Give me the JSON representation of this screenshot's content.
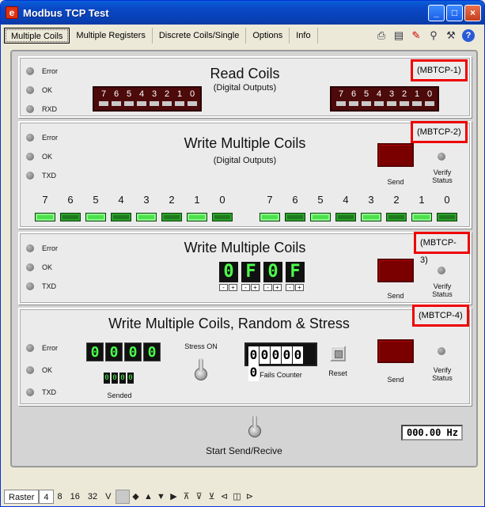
{
  "window": {
    "title": "Modbus TCP Test",
    "minimize": "_",
    "maximize": "□",
    "close": "×"
  },
  "menu": {
    "tabs": [
      "Multiple Coils",
      "Multiple Registers",
      "Discrete Coils/Single",
      "Options",
      "Info"
    ]
  },
  "tools": [
    "printer-icon",
    "clipboard-icon",
    "pen-icon",
    "tools-icon",
    "hammer-icon",
    "help-icon"
  ],
  "leds": {
    "error": "Error",
    "ok": "OK",
    "rxd": "RXD",
    "txd": "TXD"
  },
  "panel1": {
    "title": "Read Coils",
    "subtitle": "(Digital Outputs)",
    "tag": "(MBTCP-1)",
    "bits": [
      "7",
      "6",
      "5",
      "4",
      "3",
      "2",
      "1",
      "0"
    ]
  },
  "panel2": {
    "title": "Write Multiple Coils",
    "subtitle": "(Digital Outputs)",
    "tag": "(MBTCP-2)",
    "send": "Send",
    "verify": "Verify Status",
    "coil_labels": [
      "7",
      "6",
      "5",
      "4",
      "3",
      "2",
      "1",
      "0"
    ],
    "group1_states": [
      true,
      false,
      true,
      false,
      true,
      false,
      true,
      false
    ],
    "group2_states": [
      true,
      false,
      true,
      false,
      true,
      false,
      true,
      false
    ]
  },
  "panel3": {
    "title": "Write Multiple Coils",
    "tag": "(MBTCP-3)",
    "hex": [
      "0",
      "F",
      "0",
      "F"
    ],
    "minus": "-",
    "plus": "+",
    "send": "Send",
    "verify": "Verify Status"
  },
  "panel4": {
    "title": "Write Multiple Coils, Random & Stress",
    "tag": "(MBTCP-4)",
    "digits": [
      "0",
      "0",
      "0",
      "0"
    ],
    "sended_digits": [
      "0",
      "0",
      "0",
      "0"
    ],
    "sended_label": "Sended",
    "stress_label": "Stress ON",
    "fails": [
      "0",
      "0",
      "0",
      "0",
      "0",
      "0"
    ],
    "fails_label": "Fails Counter",
    "reset_label": "Reset",
    "send": "Send",
    "verify": "Verify Status"
  },
  "bottom": {
    "start_label": "Start Send/Recive",
    "hz": "000.00 Hz"
  },
  "statusbar": {
    "raster": "Raster",
    "items": [
      "4",
      "8",
      "16",
      "32",
      "V"
    ]
  }
}
